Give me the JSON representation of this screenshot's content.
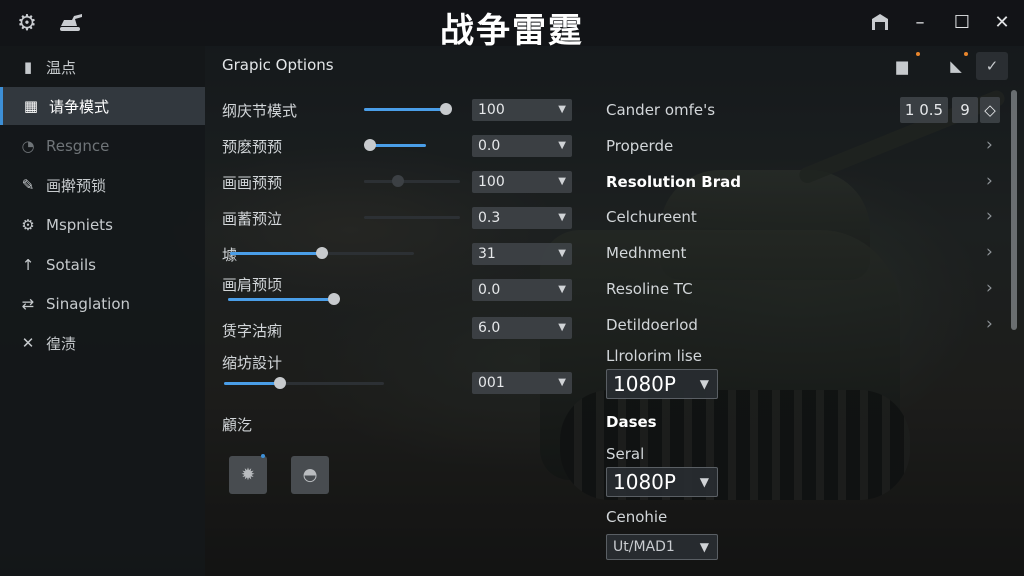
{
  "title": "战争雷霆",
  "titlebar": {
    "left_icons": [
      "gear-icon",
      "tank-icon"
    ],
    "window_controls": [
      "minimize",
      "maximize",
      "close"
    ]
  },
  "sidebar": {
    "items": [
      {
        "label": "温点",
        "icon": "document-icon",
        "state": "normal"
      },
      {
        "label": "请争模式",
        "icon": "tank-icon",
        "state": "active"
      },
      {
        "label": "Resgnce",
        "icon": "dial-icon",
        "state": "dim"
      },
      {
        "label": "画擀预锁",
        "icon": "pin-icon",
        "state": "normal"
      },
      {
        "label": "Mspniets",
        "icon": "gear-icon",
        "state": "normal"
      },
      {
        "label": "Sotails",
        "icon": "up-arrow-icon",
        "state": "normal"
      },
      {
        "label": "Sinaglation",
        "icon": "crossed-arrows-icon",
        "state": "normal"
      },
      {
        "label": "徨渍",
        "icon": "tools-icon",
        "state": "normal"
      }
    ]
  },
  "panel": {
    "title": "Grapic Options",
    "rows": [
      {
        "label": "纲庆节模式",
        "value": "100",
        "slider": 1.0
      },
      {
        "label": "预麽预预",
        "value": "0.0",
        "slider": 0.0
      },
      {
        "label": "画画预预",
        "value": "100",
        "slider": 0.35
      },
      {
        "label": "画蓄预泣",
        "value": "0.3",
        "slider": 0.0
      },
      {
        "label": "壉",
        "value": "31",
        "slider": 0.5
      },
      {
        "label": "画肩预顷",
        "value": "0.0",
        "slider": 1.0
      },
      {
        "label": "赁字沽痢",
        "value": "6.0",
        "slider": 0.0
      },
      {
        "label": "缩坊設计",
        "value": "001",
        "slider": 0.35
      }
    ],
    "bottom_label": "顧汔",
    "bottom_buttons": [
      "cog-icon",
      "helmet-icon"
    ]
  },
  "right": {
    "rows": [
      {
        "label": "Cander omfe's",
        "bold": false
      },
      {
        "label": "Properde",
        "bold": false
      },
      {
        "label": "Resolution Brad",
        "bold": true
      },
      {
        "label": "Celchureent",
        "bold": false
      },
      {
        "label": "Medhment",
        "bold": false
      },
      {
        "label": "Resoline TC",
        "bold": false
      },
      {
        "label": "Detildoerlod",
        "bold": false
      }
    ],
    "boxes": [
      "1 0.5",
      "9",
      "◇"
    ],
    "unloim_label": "Llrolorim lise",
    "resolution1": "1080P",
    "dases_label": "Dases",
    "seral_label": "Seral",
    "resolution2": "1080P",
    "cenohie_label": "Cenohie",
    "cenohie_value": "Ut/MAD1"
  },
  "colors": {
    "accent": "#4a9ee8",
    "notification": "#e8852c"
  }
}
